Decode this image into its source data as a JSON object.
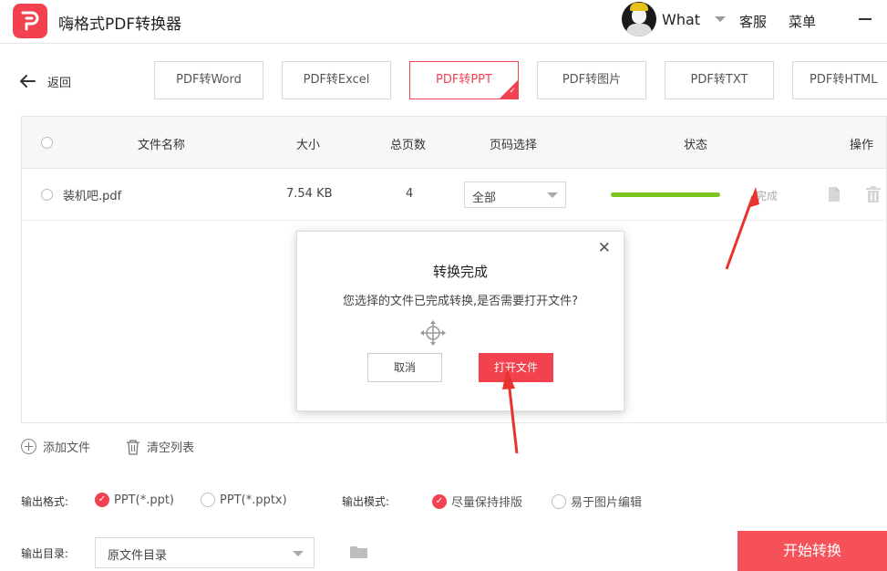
{
  "app": {
    "title": "嗨格式PDF转换器"
  },
  "user": {
    "name": "What"
  },
  "header": {
    "service": "客服",
    "menu": "菜单"
  },
  "nav": {
    "back": "返回"
  },
  "tabs": [
    {
      "label": "PDF转Word",
      "active": false
    },
    {
      "label": "PDF转Excel",
      "active": false
    },
    {
      "label": "PDF转PPT",
      "active": true
    },
    {
      "label": "PDF转图片",
      "active": false
    },
    {
      "label": "PDF转TXT",
      "active": false
    },
    {
      "label": "PDF转HTML",
      "active": false
    }
  ],
  "table": {
    "columns": {
      "name": "文件名称",
      "size": "大小",
      "pages": "总页数",
      "page_select": "页码选择",
      "status": "状态",
      "actions": "操作"
    },
    "rows": [
      {
        "name": "装机吧.pdf",
        "size": "7.54 KB",
        "pages": "4",
        "page_select": "全部",
        "progress": 100,
        "status": "完成"
      }
    ]
  },
  "dialog": {
    "title": "转换完成",
    "message": "您选择的文件已完成转换,是否需要打开文件?",
    "cancel": "取消",
    "open": "打开文件"
  },
  "actions": {
    "add_file": "添加文件",
    "clear_list": "清空列表"
  },
  "output": {
    "format_label": "输出格式:",
    "format_options": [
      "PPT(*.ppt)",
      "PPT(*.pptx)"
    ],
    "format_selected": 0,
    "mode_label": "输出模式:",
    "mode_options": [
      "尽量保持排版",
      "易于图片编辑"
    ],
    "mode_selected": 0,
    "dir_label": "输出目录:",
    "dir_value": "原文件目录",
    "start": "开始转换"
  },
  "colors": {
    "accent": "#f2424f",
    "progress": "#7ac61e",
    "annotation": "#e8332e"
  }
}
